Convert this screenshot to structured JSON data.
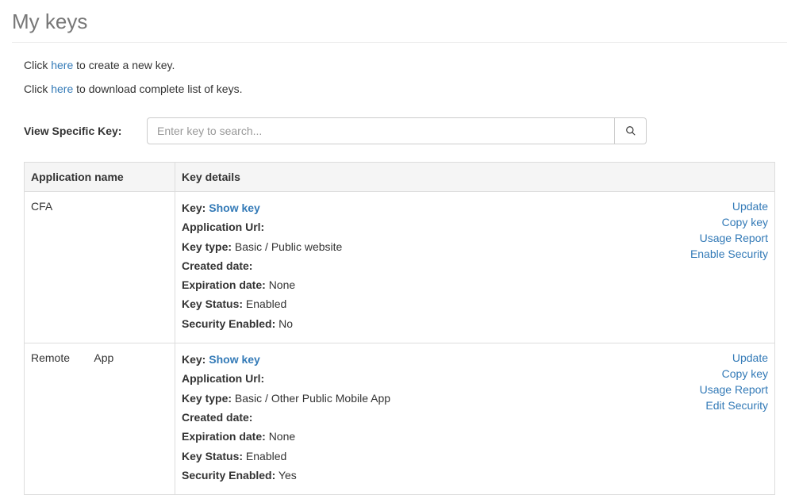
{
  "page_title": "My keys",
  "intro": {
    "line1_prefix": "Click ",
    "line1_link": "here",
    "line1_suffix": " to create a new key.",
    "line2_prefix": "Click ",
    "line2_link": "here",
    "line2_suffix": " to download complete list of keys."
  },
  "search": {
    "label": "View Specific Key:",
    "placeholder": "Enter key to search..."
  },
  "table": {
    "headers": {
      "app_name": "Application name",
      "key_details": "Key details"
    },
    "labels": {
      "key": "Key:",
      "show_key": "Show key",
      "app_url": "Application Url:",
      "key_type": "Key type:",
      "created_date": "Created date:",
      "expiration_date": "Expiration date:",
      "key_status": "Key Status:",
      "security_enabled": "Security Enabled:"
    },
    "rows": [
      {
        "app_name": "CFA",
        "app_url": "",
        "key_type": "Basic / Public website",
        "created_date": "",
        "expiration_date": "None",
        "key_status": "Enabled",
        "security_enabled": "No",
        "actions": [
          "Update",
          "Copy key",
          "Usage Report",
          "Enable Security"
        ]
      },
      {
        "app_name": "Remote        App",
        "app_url": "",
        "key_type": "Basic / Other Public Mobile App",
        "created_date": "",
        "expiration_date": "None",
        "key_status": "Enabled",
        "security_enabled": "Yes",
        "actions": [
          "Update",
          "Copy key",
          "Usage Report",
          "Edit Security"
        ]
      }
    ]
  }
}
